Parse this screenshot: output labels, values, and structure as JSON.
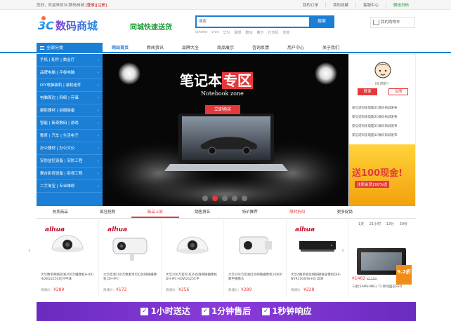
{
  "topbar": {
    "welcome": "您好，欢迎来到3C数码商城",
    "login": "[登录]",
    "reg": "[注册]",
    "links": [
      "我的订单",
      "我的收藏",
      "客服中心",
      "微信扫码"
    ]
  },
  "logo": {
    "text": "3C数码商城"
  },
  "slogan": "同城快速送货",
  "search": {
    "placeholder": "搜索",
    "button": "搜索",
    "hot": [
      "iphone",
      "vivo",
      "华为",
      "联想",
      "酷派",
      "戴尔",
      "打印机",
      "佳能"
    ]
  },
  "cart": {
    "label": "我的购物车"
  },
  "nav": {
    "all": "全部分类",
    "items": [
      "网站首页",
      "新闻资讯",
      "品牌大全",
      "商品展示",
      "咨询反馈",
      "用户中心",
      "关于我们"
    ],
    "active": 0
  },
  "sidemenu": [
    "手机 | 配件 | 数金厅",
    "品牌电脑 | 平板电脑",
    "DIY电脑装机 | 装机组件",
    "电脑周边 | 网络 | 存储",
    "摄影器材 | 拍摄装备",
    "智能 | 新奇数码 | 游戏",
    "教育 | 汽车 | 生活电子",
    "办公器材 | 办公文仪",
    "安防监控设备 | 安防工程",
    "舞台影视设备 | 影视工程",
    "二手淘宝 | 专业维修"
  ],
  "banner": {
    "title_a": "笔记本",
    "title_b": "专区",
    "subtitle": "Notebook zone",
    "button": "立即购买",
    "dots": 5,
    "active_dot": 1
  },
  "panel": {
    "greet": "Hi,你好！",
    "login": "登录",
    "register": "注册",
    "news": [
      "安信诺科技电脑3C数码商城发布",
      "安信诺科技电脑3C数码商城发布",
      "安信诺科技电脑3C数码商城发布",
      "安信诺科技电脑3C数码商城发布"
    ],
    "promo_big": "送100现金!",
    "promo_small": "注册会员100%送"
  },
  "tabs": {
    "items": [
      "热卖商品",
      "疯狂抢购",
      "新品上架",
      "销售排名",
      "特价推荐",
      "限时折扣"
    ],
    "active": 2,
    "more": "更多促销"
  },
  "products": [
    {
      "brand": "alhua",
      "name": "大华数字网络高清200万摄像机H-IPC-HDW2225C红外半球",
      "price": "¥289",
      "label": "商城价："
    },
    {
      "brand": "alhua",
      "name": "大华高清100万像素单灯红外网络摄像机 DH-IPC-",
      "price": "¥172",
      "label": "商城价："
    },
    {
      "brand": "",
      "name": "大华200万室内 红外高清网络摄像机 DH-IPC-HDW2125C半",
      "price": "¥256",
      "label": "商城价："
    },
    {
      "brand": "",
      "name": "大华200万高清红外网络摄像机1080P数字摄像头",
      "price": "¥289",
      "label": "商城价："
    },
    {
      "brand": "alhua",
      "name": "大华4路单盘位网络硬盘录像机DHI-NVR1104HS-HD 高清",
      "price": "¥228",
      "label": "商城价："
    }
  ],
  "calendar": {
    "days": [
      "1天",
      "21小时",
      "13分",
      "39秒"
    ]
  },
  "deal": {
    "price": "¥1462",
    "old": "¥1599",
    "tag": "9.2折",
    "name": "三星(SAMSUNG) T3 移动固态SSD"
  },
  "bottom": [
    "1小时送达",
    "1分钟售后",
    "1秒钟响应"
  ],
  "colors": {
    "primary": "#1b7fd6",
    "accent": "#e4393c",
    "green": "#1a9a34",
    "purple": "#7b34cc"
  }
}
